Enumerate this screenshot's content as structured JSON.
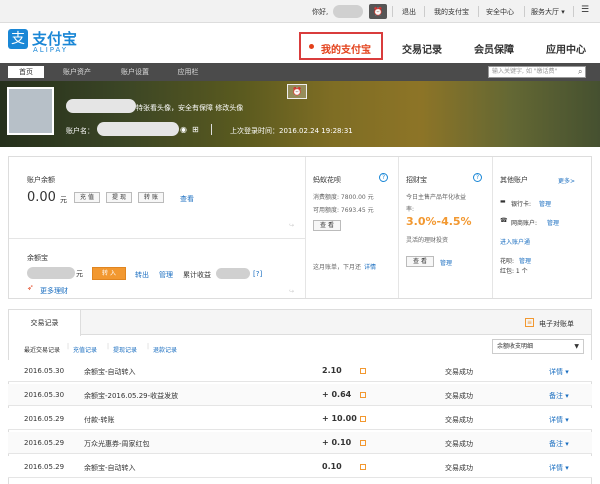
{
  "topbar": {
    "greeting": "你好,",
    "logout": "退出",
    "my_alipay": "我的支付宝",
    "security": "安全中心",
    "service": "服务大厅 ▾"
  },
  "brand": {
    "logo_char": "支",
    "name_cn": "支付宝",
    "name_en": "ALIPAY"
  },
  "nav": {
    "my_alipay": "我的支付宝",
    "records": "交易记录",
    "member": "会员保障",
    "apps": "应用中心"
  },
  "subnav": {
    "tabs": [
      "首页",
      "账户资产",
      "账户设置",
      "应用栏"
    ],
    "search_placeholder": "输入关键字, 如 \"缴话费\""
  },
  "banner": {
    "upload_hint": "特张看头像，安全有保障 修改头像",
    "account_label": "账户名：",
    "last_login": "上次登录时间：2016.02.24 19:28:31"
  },
  "balance": {
    "title": "账户余额",
    "amount": "0.00",
    "unit": "元",
    "btn_recharge": "充 值",
    "btn_withdraw": "提 现",
    "btn_transfer": "转 账",
    "view": "查看"
  },
  "yuebao": {
    "title": "余额宝",
    "unit": "元",
    "btn_in": "转 入",
    "out": "转出",
    "manage": "管理",
    "earnings": "累计收益",
    "help": "[?]",
    "more": "更多理财"
  },
  "huabei": {
    "title": "蚂蚁花呗",
    "quota_label": "消费额度: 7800.00 元",
    "available_label": "可用额度: 7693.45 元",
    "btn_view": "查 看",
    "bill": "这月账单，下月还",
    "detail": "详情"
  },
  "zhaocai": {
    "title": "招财宝",
    "desc_line1": "今日主售产品年化收益",
    "desc_line2": "率:",
    "rate": "3.0%-4.5%",
    "sub": "灵活的理财投资",
    "btn_view": "查 看",
    "manage": "管理"
  },
  "others": {
    "title": "其他账户",
    "more": "更多>",
    "bankcard": "银行卡:",
    "bankcard_link": "管理",
    "network": "网商账户:",
    "network_link": "管理",
    "enter": "进入账户通",
    "huabei_label": "花呗:",
    "huabei_link": "管理",
    "redpack": "红包: 1 个"
  },
  "records": {
    "tab": "交易记录",
    "ebill": "电子对账单",
    "filters": [
      "最近交易记录",
      "充值记录",
      "提现记录",
      "退款记录"
    ],
    "select_value": "余额收支明细",
    "rows": [
      {
        "date": "2016.05.30",
        "name": "余额宝-自动转入",
        "amount": "2.10",
        "status": "交易成功",
        "action": "详情 ▾"
      },
      {
        "date": "2016.05.30",
        "name": "余额宝-2016.05.29-收益发放",
        "amount": "+ 0.64",
        "status": "交易成功",
        "action": "备注 ▾"
      },
      {
        "date": "2016.05.29",
        "name": "付款-转账",
        "amount": "+ 10.00",
        "status": "交易成功",
        "action": "详情 ▾"
      },
      {
        "date": "2016.05.29",
        "name": "万众光惠券-周家红包",
        "amount": "+ 0.10",
        "status": "交易成功",
        "action": "备注 ▾"
      },
      {
        "date": "2016.05.29",
        "name": "余额宝-自动转入",
        "amount": "0.10",
        "status": "交易成功",
        "action": "详情 ▾"
      }
    ]
  },
  "colors": {
    "brand": "#1a87d6",
    "accent": "#e3401a",
    "orange": "#f29830"
  }
}
